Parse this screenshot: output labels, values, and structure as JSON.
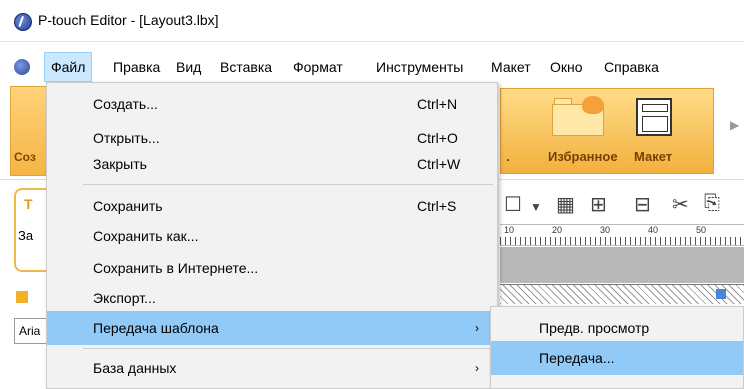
{
  "window": {
    "title": "P-touch Editor - [Layout3.lbx]"
  },
  "menubar": {
    "items": [
      "Файл",
      "Правка",
      "Вид",
      "Вставка",
      "Формат",
      "Инструменты",
      "Макет",
      "Окно",
      "Справка"
    ]
  },
  "ribbon": {
    "left_label": "Соз",
    "favorites_label": "Избранное",
    "layout_label": "Макет",
    "partial_label": "."
  },
  "panel": {
    "title_fragment": "Т",
    "text_fragment": "За",
    "font_fragment": "Aria"
  },
  "ruler": {
    "ticks": [
      "10",
      "20",
      "30",
      "40",
      "50"
    ]
  },
  "file_menu": {
    "items": [
      {
        "label": "Создать...",
        "shortcut": "Ctrl+N"
      },
      {
        "label": "Открыть...",
        "shortcut": "Ctrl+O"
      },
      {
        "label": "Закрыть",
        "shortcut": "Ctrl+W"
      },
      {
        "label": "Сохранить",
        "shortcut": "Ctrl+S"
      },
      {
        "label": "Сохранить как...",
        "shortcut": ""
      },
      {
        "label": "Сохранить в Интернете...",
        "shortcut": ""
      },
      {
        "label": "Экспорт...",
        "shortcut": ""
      },
      {
        "label": "Передача шаблона",
        "shortcut": "",
        "arrow": "›"
      },
      {
        "label": "База данных",
        "shortcut": "",
        "arrow": "›"
      }
    ]
  },
  "submenu": {
    "items": [
      {
        "label": "Предв. просмотр"
      },
      {
        "label": "Передача..."
      }
    ]
  },
  "colors": {
    "highlight": "#91c9f7",
    "ribbon_orange": "#f2b13e"
  }
}
